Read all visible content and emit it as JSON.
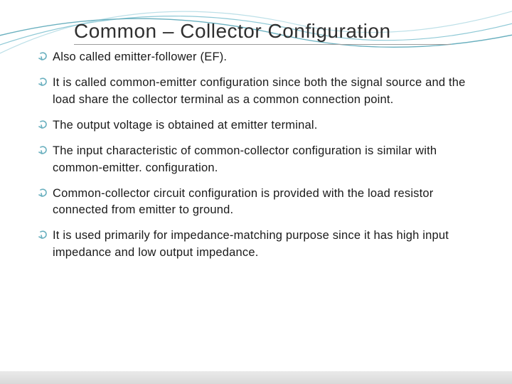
{
  "title": "Common – Collector Configuration",
  "bullets": [
    "Also called emitter-follower (EF).",
    "It is called common-emitter configuration since both the signal source and the load share the collector terminal as a common connection point.",
    "The output voltage is obtained at emitter terminal.",
    "The input characteristic of common-collector configuration is similar with common-emitter. configuration.",
    "Common-collector circuit configuration is provided with the load resistor connected from emitter to ground.",
    "It is used primarily for impedance-matching purpose since it has high input impedance and low output impedance."
  ]
}
